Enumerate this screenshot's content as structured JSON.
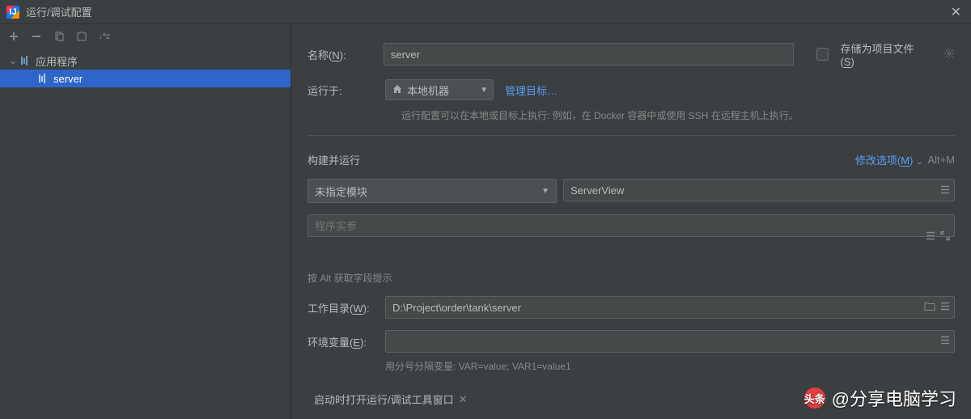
{
  "window": {
    "title": "运行/调试配置"
  },
  "sidebar": {
    "tree": {
      "root_label": "应用程序",
      "selected_item": "server"
    }
  },
  "form": {
    "name_label_pre": "名称(",
    "name_label_key": "N",
    "name_label_post": "):",
    "name_value": "server",
    "store_as_file_pre": "存储为项目文件(",
    "store_as_file_key": "S",
    "store_as_file_post": ")",
    "run_on_label": "运行于:",
    "run_on_value": "本地机器",
    "manage_targets": "管理目标…",
    "run_on_hint": "运行配置可以在本地或目标上执行: 例如，在 Docker 容器中或使用 SSH 在远程主机上执行。",
    "build_run_title": "构建并运行",
    "modify_options_pre": "修改选项(",
    "modify_options_key": "M",
    "modify_options_post": ")",
    "modify_shortcut": "Alt+M",
    "module_value": "未指定模块",
    "main_class_value": "ServerView",
    "program_args_placeholder": "程序实参",
    "alt_hint": "按 Alt 获取字段提示",
    "workdir_label_pre": "工作目录(",
    "workdir_label_key": "W",
    "workdir_label_post": "):",
    "workdir_value": "D:\\Project\\order\\tank\\server",
    "env_label_pre": "环境变量(",
    "env_label_key": "E",
    "env_label_post": "):",
    "env_hint": "用分号分隔变量: VAR=value; VAR1=value1",
    "open_tool_window": "启动时打开运行/调试工具窗口"
  },
  "watermark": {
    "logo": "头条",
    "text": "@分享电脑学习"
  }
}
